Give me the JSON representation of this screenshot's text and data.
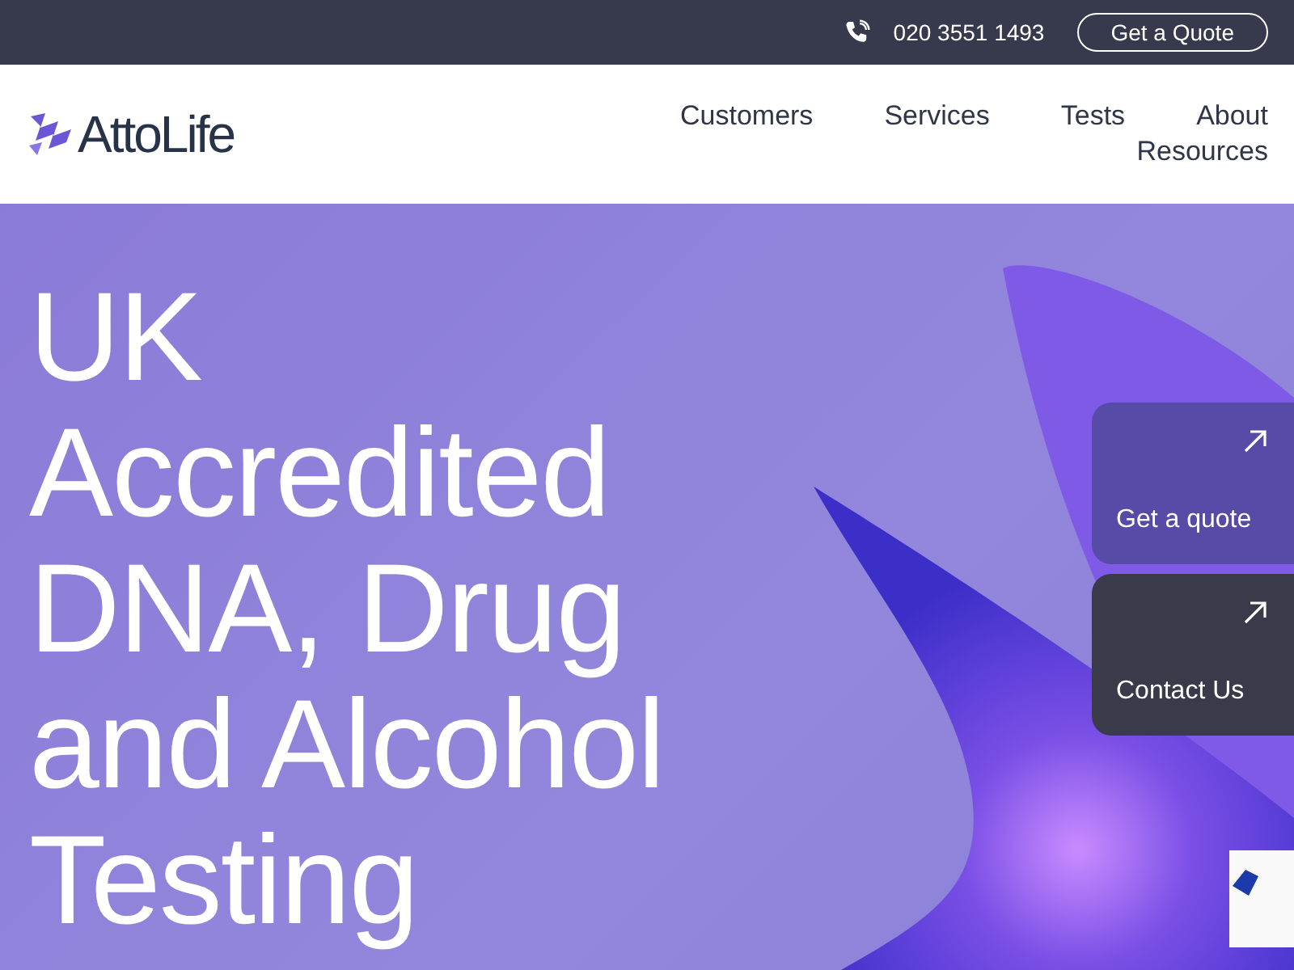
{
  "top_bar": {
    "phone": "020 3551 1493",
    "quote_button": "Get a Quote"
  },
  "header": {
    "logo": "AttoLife",
    "nav": [
      "Customers",
      "Services",
      "Tests",
      "About",
      "Resources"
    ]
  },
  "hero": {
    "heading": "UK Accredited DNA, Drug and Alcohol Testing"
  },
  "side_actions": [
    {
      "label": "Get a quote",
      "kind": "accent"
    },
    {
      "label": "Contact Us",
      "kind": "dark"
    }
  ]
}
